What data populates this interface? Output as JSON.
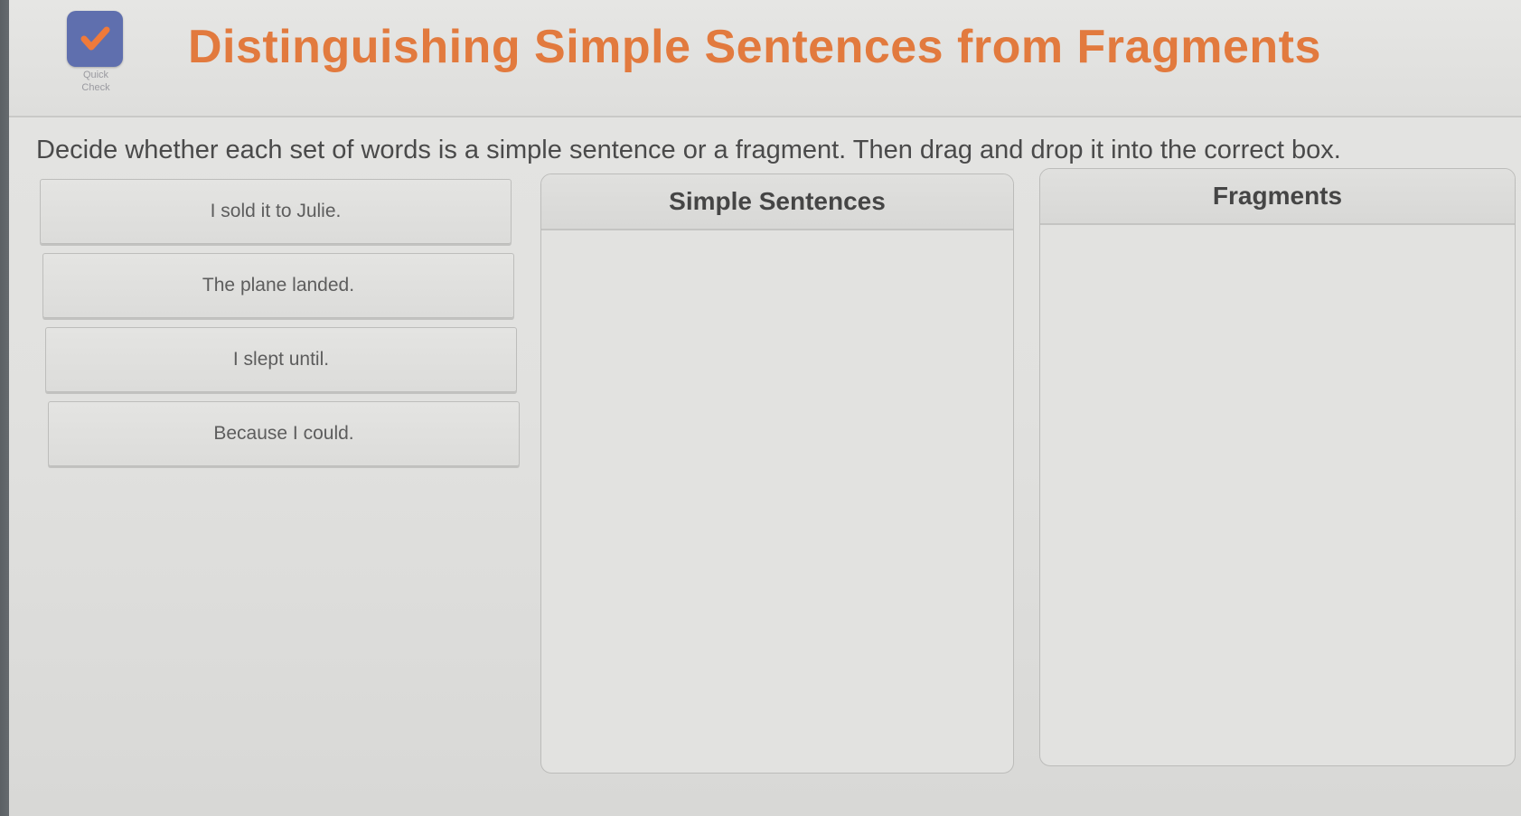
{
  "header": {
    "badge_label": "Quick Check",
    "title": "Distinguishing Simple Sentences from Fragments",
    "badge_icon": "checkmark-icon",
    "title_color": "#e27a3e",
    "badge_color": "#5f6fae"
  },
  "instructions": "Decide whether each set of words is a simple sentence or a fragment. Then drag and drop it into the correct box.",
  "cards": [
    {
      "label": "I sold it to Julie."
    },
    {
      "label": "The plane landed."
    },
    {
      "label": "I slept until."
    },
    {
      "label": "Because I could."
    }
  ],
  "boxes": {
    "simple": {
      "label": "Simple Sentences"
    },
    "fragments": {
      "label": "Fragments"
    }
  }
}
